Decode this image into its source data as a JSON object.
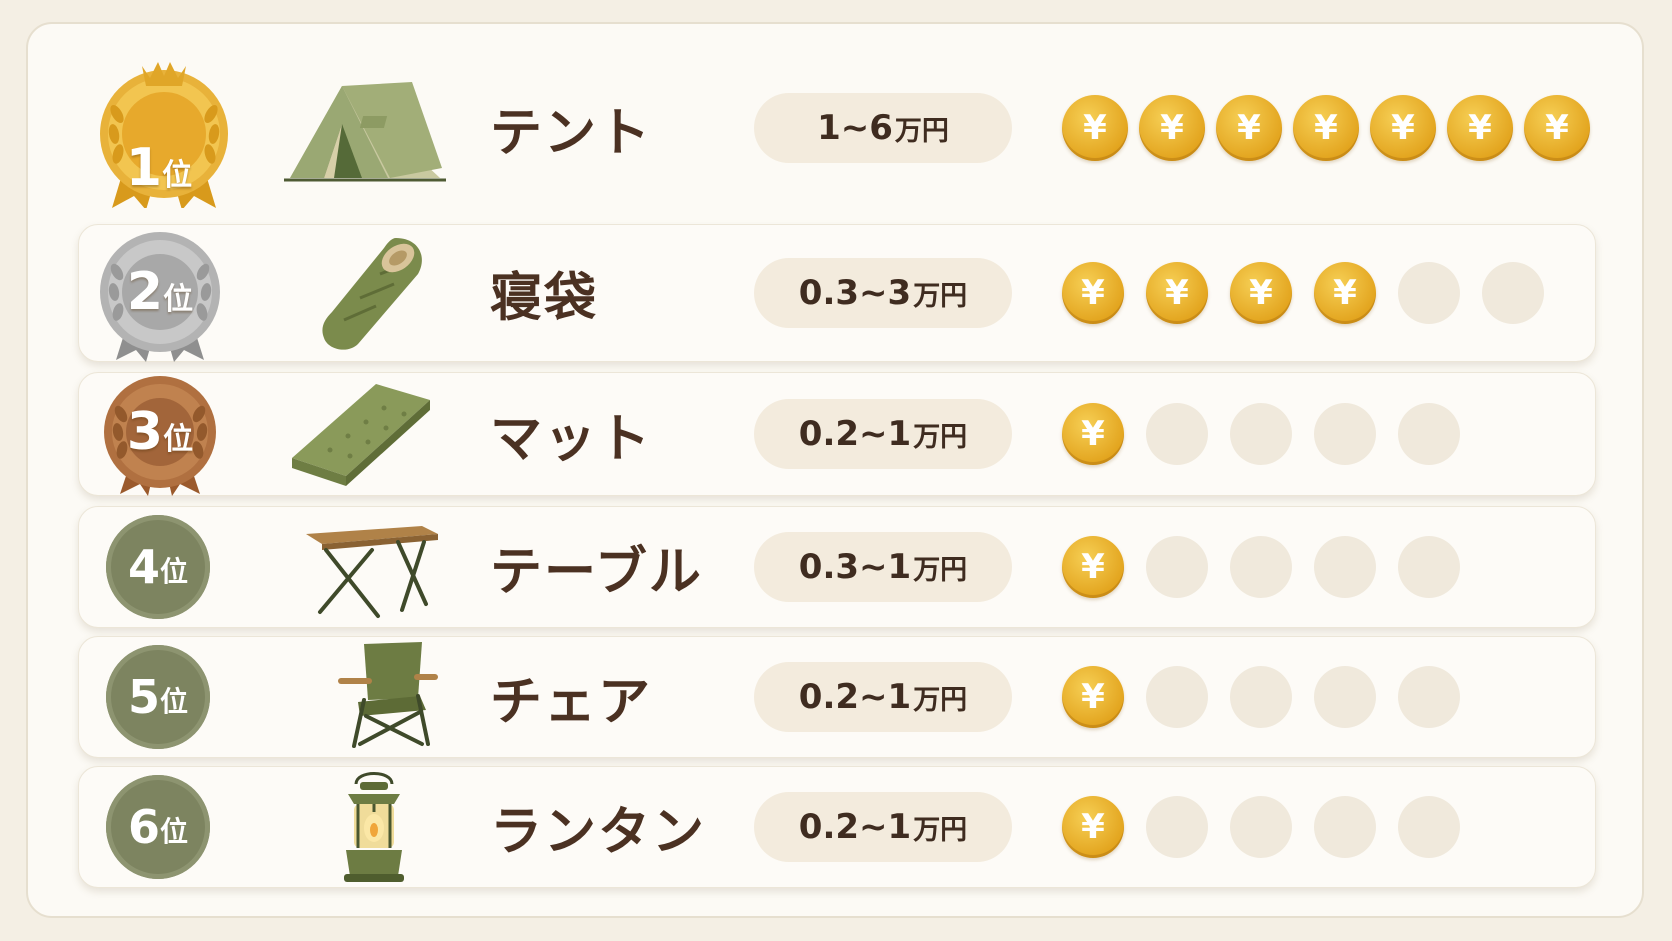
{
  "colors": {
    "background": "#f4efe4",
    "panel": "#fcfaf5",
    "text": "#4b3122",
    "price_pill": "#f3ebdd",
    "coin_gold": "#e3a51f",
    "coin_empty": "#f0e9dc",
    "olive": "#7d8460",
    "gold_medal": "#e0a628",
    "silver_medal": "#a6a6a6",
    "bronze_medal": "#a8683a"
  },
  "coin_symbol": "¥",
  "rankings": [
    {
      "rank_number": "1",
      "rank_suffix": "位",
      "medal": "gold",
      "icon": "tent-icon",
      "name": "テント",
      "price": "1~6",
      "unit": "万円",
      "filled": 7,
      "total": 7
    },
    {
      "rank_number": "2",
      "rank_suffix": "位",
      "medal": "silver",
      "icon": "sleeping-bag-icon",
      "name": "寝袋",
      "price": "0.3~3",
      "unit": "万円",
      "filled": 4,
      "total": 6
    },
    {
      "rank_number": "3",
      "rank_suffix": "位",
      "medal": "bronze",
      "icon": "mat-icon",
      "name": "マット",
      "price": "0.2~1",
      "unit": "万円",
      "filled": 1,
      "total": 5
    },
    {
      "rank_number": "4",
      "rank_suffix": "位",
      "medal": "plain",
      "icon": "table-icon",
      "name": "テーブル",
      "price": "0.3~1",
      "unit": "万円",
      "filled": 1,
      "total": 5
    },
    {
      "rank_number": "5",
      "rank_suffix": "位",
      "medal": "plain",
      "icon": "chair-icon",
      "name": "チェア",
      "price": "0.2~1",
      "unit": "万円",
      "filled": 1,
      "total": 5
    },
    {
      "rank_number": "6",
      "rank_suffix": "位",
      "medal": "plain",
      "icon": "lantern-icon",
      "name": "ランタン",
      "price": "0.2~1",
      "unit": "万円",
      "filled": 1,
      "total": 5
    }
  ]
}
